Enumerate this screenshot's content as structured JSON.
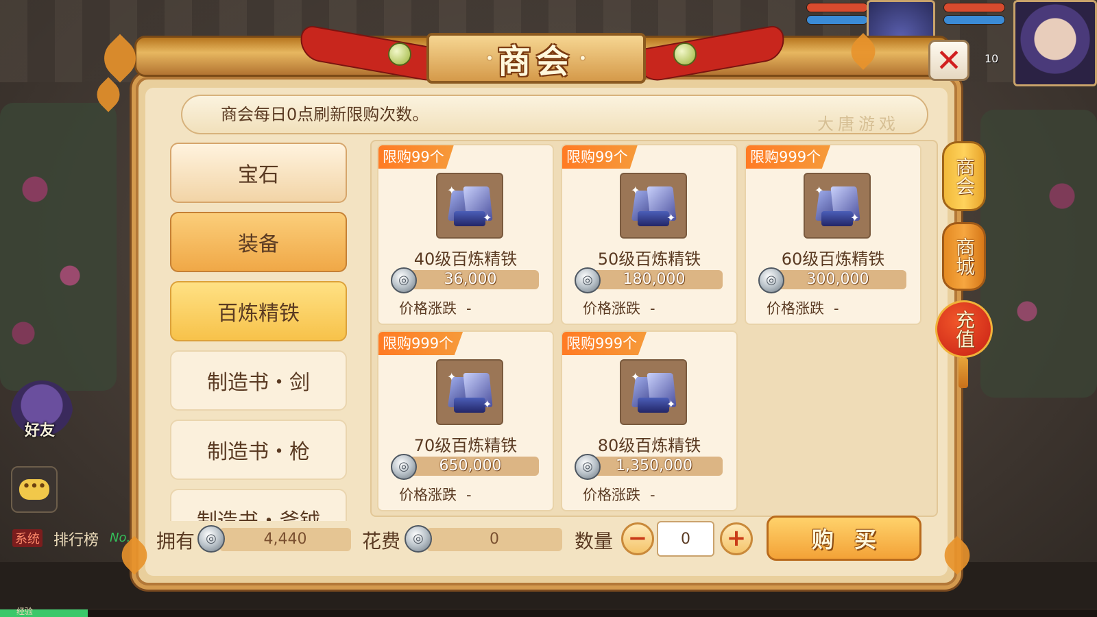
{
  "panel": {
    "title": "商会",
    "notice": "商会每日0点刷新限购次数。",
    "notice_deco": "大唐游戏",
    "close_symbol": "✕"
  },
  "categories": [
    {
      "label": "宝石",
      "style": "a"
    },
    {
      "label": "装备",
      "style": "b"
    },
    {
      "label": "百炼精铁",
      "style": "active"
    },
    {
      "label": "制造书・剑",
      "style": "plain"
    },
    {
      "label": "制造书・枪",
      "style": "plain"
    },
    {
      "label": "制造书・斧钺",
      "style": "plain"
    }
  ],
  "items": [
    {
      "limit": "限购99个",
      "name": "40级百炼精铁",
      "price": "36,000",
      "change_label": "价格涨跌",
      "change_value": "-"
    },
    {
      "limit": "限购99个",
      "name": "50级百炼精铁",
      "price": "180,000",
      "change_label": "价格涨跌",
      "change_value": "-"
    },
    {
      "limit": "限购999个",
      "name": "60级百炼精铁",
      "price": "300,000",
      "change_label": "价格涨跌",
      "change_value": "-"
    },
    {
      "limit": "限购999个",
      "name": "70级百炼精铁",
      "price": "650,000",
      "change_label": "价格涨跌",
      "change_value": "-"
    },
    {
      "limit": "限购999个",
      "name": "80级百炼精铁",
      "price": "1,350,000",
      "change_label": "价格涨跌",
      "change_value": "-"
    }
  ],
  "footer": {
    "own_label": "拥有",
    "own_value": "4,440",
    "cost_label": "花费",
    "cost_value": "0",
    "qty_label": "数量",
    "qty_value": "0",
    "minus": "−",
    "plus": "+",
    "buy_label": "购买"
  },
  "side_tabs": {
    "shanghui": "商会",
    "shangcheng": "商城",
    "chongzhi": "充值"
  },
  "hud": {
    "friend_label": "好友",
    "chat_label": "•••",
    "system_tag": "系统",
    "rank_label": "排行榜",
    "rank_no": "No.",
    "exp_label": "经验",
    "level": "10"
  }
}
